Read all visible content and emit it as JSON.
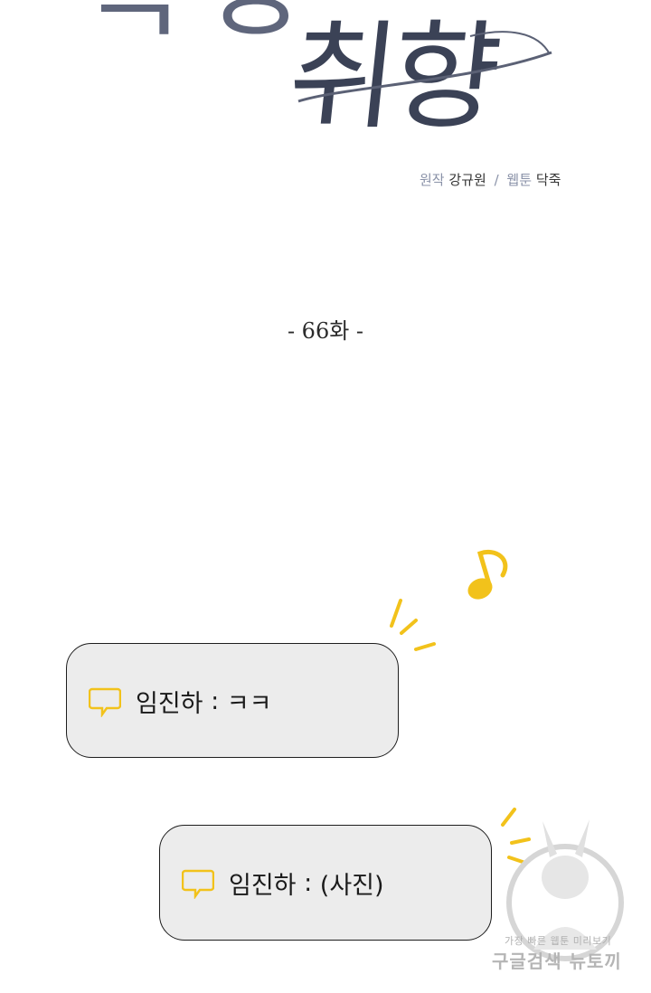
{
  "header": {
    "title_partial": "특정",
    "title": "취향",
    "credits": {
      "original_label": "원작",
      "original_author": "강규원",
      "separator": "/",
      "webtoon_label": "웹툰",
      "webtoon_author": "닥죽"
    }
  },
  "episode": {
    "label": "- 66화 -"
  },
  "messages": [
    {
      "sender": "임진하",
      "separator": " : ",
      "text": "ㅋㅋ"
    },
    {
      "sender": "임진하",
      "separator": " : ",
      "text": "(사진)"
    }
  ],
  "watermark": {
    "line1": "가장 빠른 웹툰 미리보기",
    "line2": "구글검색 뉴토끼"
  },
  "colors": {
    "title": "#3b4256",
    "accent_yellow": "#f2c21b",
    "bubble_fill": "#ececec",
    "bubble_border": "#1e1e1e"
  }
}
